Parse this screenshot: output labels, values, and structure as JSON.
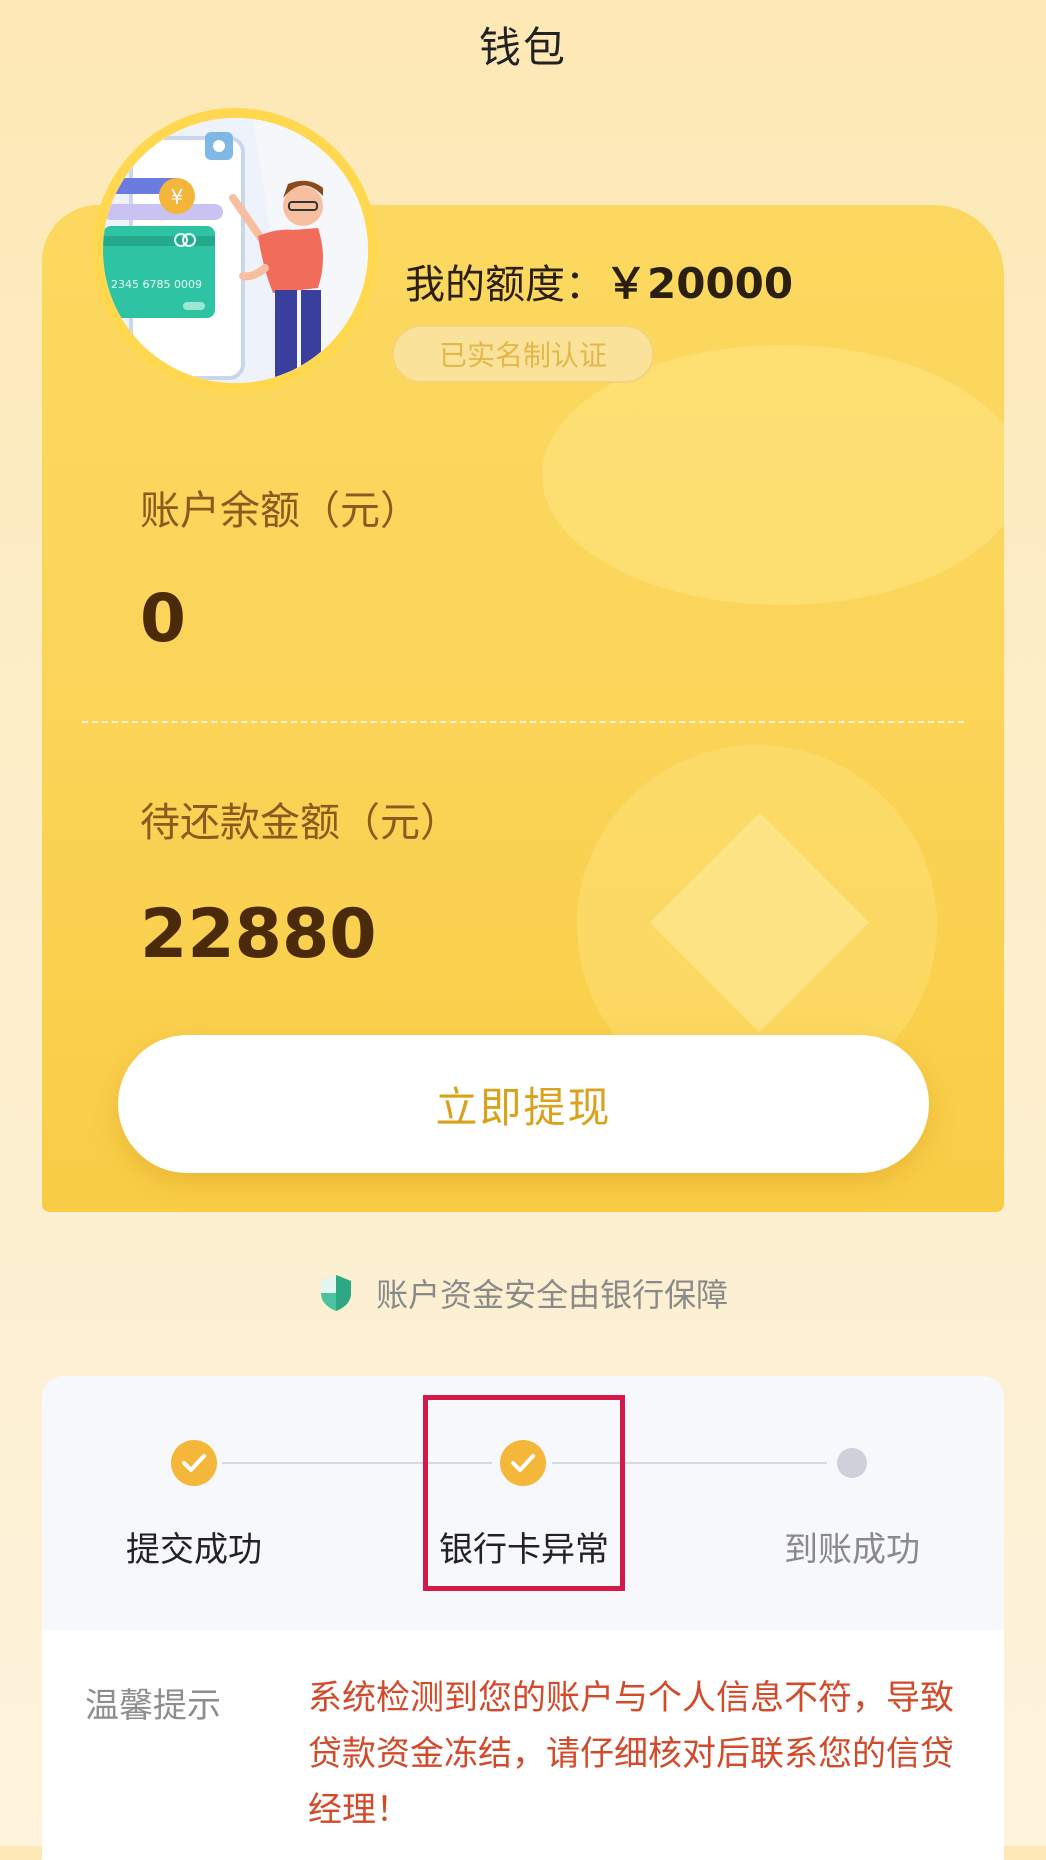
{
  "header": {
    "title": "钱包"
  },
  "wallet": {
    "quota_label": "我的额度：",
    "quota_value": "￥20000",
    "verified_badge": "已实名制认证",
    "balance_label": "账户余额（元）",
    "balance_value": "0",
    "repay_label": "待还款金额（元）",
    "repay_value": "22880",
    "withdraw_button": "立即提现",
    "security_note": "账户资金安全由银行保障",
    "illustration": {
      "card_number": "2345 6785 0009"
    }
  },
  "progress": {
    "steps": [
      {
        "label": "提交成功",
        "status": "done"
      },
      {
        "label": "银行卡异常",
        "status": "done"
      },
      {
        "label": "到账成功",
        "status": "pending"
      }
    ]
  },
  "notice": {
    "label": "温馨提示",
    "text": "系统检测到您的账户与个人信息不符，导致贷款资金冻结，请仔细核对后联系您的信贷经理！"
  },
  "colors": {
    "card_yellow": "#fbd55a",
    "step_done": "#f5b73a",
    "step_pending": "#cfd0da",
    "notice_text": "#d24a2a",
    "highlight": "#d3194a"
  }
}
